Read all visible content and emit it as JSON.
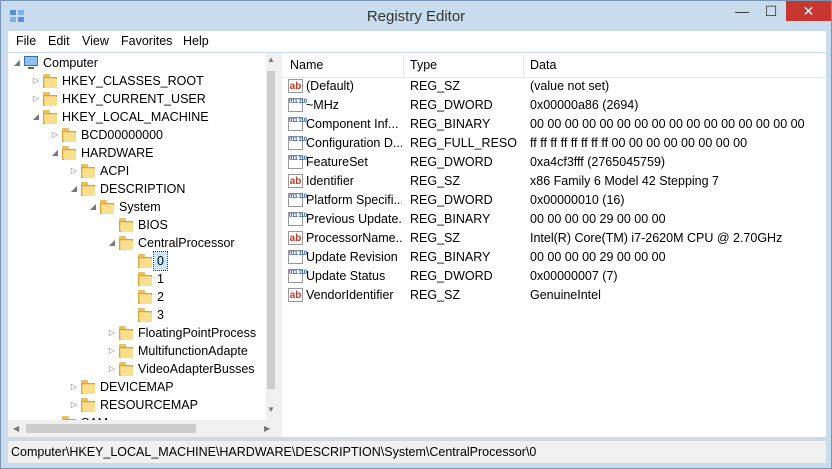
{
  "window": {
    "title": "Registry Editor",
    "min_glyph": "—",
    "max_glyph": "☐",
    "close_glyph": "✕"
  },
  "menu": [
    "File",
    "Edit",
    "View",
    "Favorites",
    "Help"
  ],
  "tree": [
    {
      "label": "Computer",
      "level": 0,
      "expander": "◢",
      "icon": "computer"
    },
    {
      "label": "HKEY_CLASSES_ROOT",
      "level": 1,
      "expander": "▷"
    },
    {
      "label": "HKEY_CURRENT_USER",
      "level": 1,
      "expander": "▷"
    },
    {
      "label": "HKEY_LOCAL_MACHINE",
      "level": 1,
      "expander": "◢"
    },
    {
      "label": "BCD00000000",
      "level": 2,
      "expander": "▷"
    },
    {
      "label": "HARDWARE",
      "level": 2,
      "expander": "◢"
    },
    {
      "label": "ACPI",
      "level": 3,
      "expander": "▷"
    },
    {
      "label": "DESCRIPTION",
      "level": 3,
      "expander": "◢"
    },
    {
      "label": "System",
      "level": 4,
      "expander": "◢"
    },
    {
      "label": "BIOS",
      "level": 5,
      "expander": ""
    },
    {
      "label": "CentralProcessor",
      "level": 5,
      "expander": "◢"
    },
    {
      "label": "0",
      "level": 6,
      "expander": "",
      "selected": true
    },
    {
      "label": "1",
      "level": 6,
      "expander": ""
    },
    {
      "label": "2",
      "level": 6,
      "expander": ""
    },
    {
      "label": "3",
      "level": 6,
      "expander": ""
    },
    {
      "label": "FloatingPointProcess",
      "level": 5,
      "expander": "▷"
    },
    {
      "label": "MultifunctionAdapte",
      "level": 5,
      "expander": "▷"
    },
    {
      "label": "VideoAdapterBusses",
      "level": 5,
      "expander": "▷"
    },
    {
      "label": "DEVICEMAP",
      "level": 3,
      "expander": "▷"
    },
    {
      "label": "RESOURCEMAP",
      "level": 3,
      "expander": "▷"
    },
    {
      "label": "SAM",
      "level": 2,
      "expander": ""
    }
  ],
  "columns": {
    "name": "Name",
    "type": "Type",
    "data": "Data"
  },
  "values": [
    {
      "name": "(Default)",
      "type": "REG_SZ",
      "data": "(value not set)",
      "icon": "string"
    },
    {
      "name": "~MHz",
      "type": "REG_DWORD",
      "data": "0x00000a86 (2694)",
      "icon": "binary"
    },
    {
      "name": "Component Inf...",
      "type": "REG_BINARY",
      "data": "00 00 00 00 00 00 00 00 00 00 00 00 00 00 00 00",
      "icon": "binary"
    },
    {
      "name": "Configuration D...",
      "type": "REG_FULL_RESOU...",
      "data": "ff ff ff ff ff ff ff ff 00 00 00 00 00 00 00 00",
      "icon": "binary"
    },
    {
      "name": "FeatureSet",
      "type": "REG_DWORD",
      "data": "0xa4cf3fff (2765045759)",
      "icon": "binary"
    },
    {
      "name": "Identifier",
      "type": "REG_SZ",
      "data": "x86 Family 6 Model 42 Stepping 7",
      "icon": "string"
    },
    {
      "name": "Platform Specifi...",
      "type": "REG_DWORD",
      "data": "0x00000010 (16)",
      "icon": "binary"
    },
    {
      "name": "Previous Update...",
      "type": "REG_BINARY",
      "data": "00 00 00 00 29 00 00 00",
      "icon": "binary"
    },
    {
      "name": "ProcessorName...",
      "type": "REG_SZ",
      "data": "Intel(R) Core(TM) i7-2620M CPU @ 2.70GHz",
      "icon": "string"
    },
    {
      "name": "Update Revision",
      "type": "REG_BINARY",
      "data": "00 00 00 00 29 00 00 00",
      "icon": "binary"
    },
    {
      "name": "Update Status",
      "type": "REG_DWORD",
      "data": "0x00000007 (7)",
      "icon": "binary"
    },
    {
      "name": "VendorIdentifier",
      "type": "REG_SZ",
      "data": "GenuineIntel",
      "icon": "string"
    }
  ],
  "icon_glyphs": {
    "string": "ab",
    "binary": "011 110"
  },
  "status": "Computer\\HKEY_LOCAL_MACHINE\\HARDWARE\\DESCRIPTION\\System\\CentralProcessor\\0",
  "colors": {
    "title_bg": "#c9dced",
    "close_button": "#c7372f",
    "selection": "#cce8ff"
  }
}
